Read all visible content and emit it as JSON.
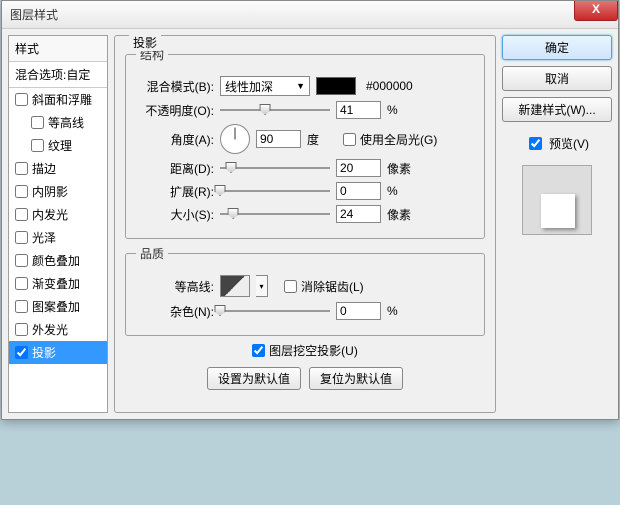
{
  "title": "图层样式",
  "close": "X",
  "sidebar": {
    "header": "样式",
    "blend": "混合选项:自定",
    "items": [
      {
        "label": "斜面和浮雕",
        "checked": false,
        "indent": false
      },
      {
        "label": "等高线",
        "checked": false,
        "indent": true
      },
      {
        "label": "纹理",
        "checked": false,
        "indent": true
      },
      {
        "label": "描边",
        "checked": false,
        "indent": false
      },
      {
        "label": "内阴影",
        "checked": false,
        "indent": false
      },
      {
        "label": "内发光",
        "checked": false,
        "indent": false
      },
      {
        "label": "光泽",
        "checked": false,
        "indent": false
      },
      {
        "label": "颜色叠加",
        "checked": false,
        "indent": false
      },
      {
        "label": "渐变叠加",
        "checked": false,
        "indent": false
      },
      {
        "label": "图案叠加",
        "checked": false,
        "indent": false
      },
      {
        "label": "外发光",
        "checked": false,
        "indent": false
      },
      {
        "label": "投影",
        "checked": true,
        "indent": false,
        "selected": true
      }
    ]
  },
  "panel": {
    "title": "投影",
    "structure": {
      "legend": "结构",
      "blend_mode_label": "混合模式(B):",
      "blend_mode_value": "线性加深",
      "color_hex": "#000000",
      "opacity_label": "不透明度(O):",
      "opacity_value": "41",
      "opacity_unit": "%",
      "angle_label": "角度(A):",
      "angle_value": "90",
      "angle_unit": "度",
      "global_light_label": "使用全局光(G)",
      "distance_label": "距离(D):",
      "distance_value": "20",
      "distance_unit": "像素",
      "spread_label": "扩展(R):",
      "spread_value": "0",
      "spread_unit": "%",
      "size_label": "大小(S):",
      "size_value": "24",
      "size_unit": "像素"
    },
    "quality": {
      "legend": "品质",
      "contour_label": "等高线:",
      "antialias_label": "消除锯齿(L)",
      "noise_label": "杂色(N):",
      "noise_value": "0",
      "noise_unit": "%"
    },
    "knockout_label": "图层挖空投影(U)",
    "set_default": "设置为默认值",
    "reset_default": "复位为默认值"
  },
  "right": {
    "ok": "确定",
    "cancel": "取消",
    "new_style": "新建样式(W)...",
    "preview_label": "预览(V)"
  }
}
